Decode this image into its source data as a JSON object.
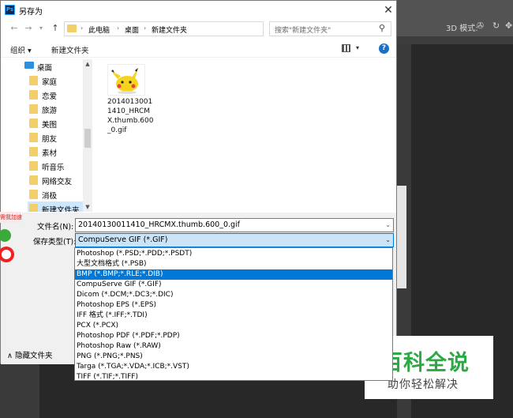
{
  "window": {
    "title": "另存为",
    "app_icon": "Ps"
  },
  "address": {
    "crumbs": [
      "此电脑",
      "桌面",
      "新建文件夹"
    ],
    "search_placeholder": "搜索\"新建文件夹\""
  },
  "toolbar": {
    "organize": "组织 ▾",
    "new_folder": "新建文件夹"
  },
  "nav": {
    "items": [
      "桌面",
      "家庭",
      "恋爱",
      "旅游",
      "美图",
      "朋友",
      "素材",
      "听音乐",
      "网络交友",
      "消极",
      "新建文件夹"
    ]
  },
  "files": [
    {
      "name": "20140130011410_HRCMX.thumb.600_0.gif"
    }
  ],
  "form": {
    "filename_label": "文件名(N):",
    "filename_value": "20140130011410_HRCMX.thumb.600_0.gif",
    "type_label": "保存类型(T):",
    "type_value": "CompuServe GIF (*.GIF)",
    "options": [
      "Photoshop (*.PSD;*.PDD;*.PSDT)",
      "大型文档格式 (*.PSB)",
      "BMP (*.BMP;*.RLE;*.DIB)",
      "CompuServe GIF (*.GIF)",
      "Dicom (*.DCM;*.DC3;*.DIC)",
      "Photoshop EPS (*.EPS)",
      "IFF 格式 (*.IFF;*.TDI)",
      "PCX (*.PCX)",
      "Photoshop PDF (*.PDF;*.PDP)",
      "Photoshop Raw (*.RAW)",
      "PNG (*.PNG;*.PNS)",
      "Targa (*.TGA;*.VDA;*.ICB;*.VST)",
      "TIFF (*.TIF;*.TIFF)"
    ],
    "highlighted_option": "BMP (*.BMP;*.RLE;*.DIB)",
    "hide_folders": "∧ 隐藏文件夹"
  },
  "ps_toolbar": {
    "mode_3d": "3D 模式:"
  },
  "badge": {
    "text": "需我加速"
  },
  "watermark": {
    "title": "百科全说",
    "subtitle": "助你轻松解决"
  }
}
